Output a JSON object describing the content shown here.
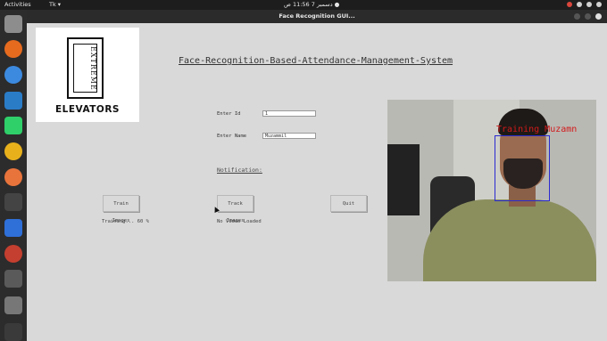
{
  "topbar": {
    "activities": "Activities",
    "app_menu": "Tk ▾",
    "clock": "دسمبر 7  11:56 ص  ●"
  },
  "window": {
    "title": "Face Recognition GUI..."
  },
  "logo": {
    "mark_text": "EXTREME",
    "wordmark": "ELEVATORS"
  },
  "main": {
    "title": "Face-Recognition-Based-Attendance-Management-System",
    "id_label": "Enter Id",
    "id_value": "1",
    "name_label": "Enter Name",
    "name_value": "Muzammil",
    "notification_label": "Notification:",
    "buttons": {
      "train": "Train Images",
      "track": "Track Images",
      "quit": "Quit"
    },
    "status_train": "Training... 60 %",
    "status_track": "No Video Loaded"
  },
  "camera": {
    "overlay_label": "Training Muzamn"
  },
  "colors": {
    "face_box": "#2a2ad0",
    "overlay_text": "#d11a1a"
  }
}
